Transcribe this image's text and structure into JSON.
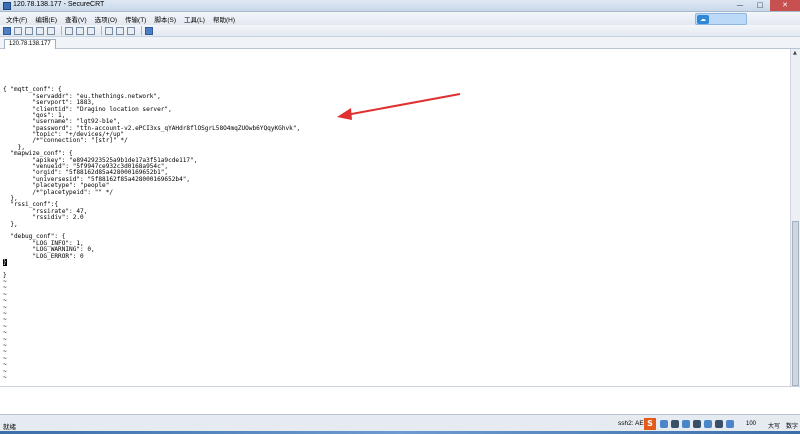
{
  "window": {
    "title": "120.78.138.177 - SecureCRT",
    "controls": [
      "—",
      "□",
      "✕"
    ]
  },
  "menu": [
    "文件(F)",
    "编辑(E)",
    "查看(V)",
    "选项(O)",
    "传输(T)",
    "脚本(S)",
    "工具(L)",
    "帮助(H)"
  ],
  "toolbar": {
    "buttons": [
      "connect-icon",
      "quick-connect-icon",
      "connect-tab-icon",
      "reconnect-icon",
      "disconnect-icon",
      "copy-icon",
      "paste-icon",
      "find-icon",
      "print-icon",
      "settings-icon",
      "keymap-icon",
      "help-icon"
    ]
  },
  "tab": {
    "label": "120.78.138.177"
  },
  "terminal": {
    "lines": [
      "",
      "",
      "",
      "",
      "",
      "",
      "{ \"mqtt_conf\": {",
      "        \"servaddr\": \"eu.thethings.network\",",
      "        \"servport\": 1883,",
      "        \"clientid\": \"Dragino location server\",",
      "        \"qos\": 1,",
      "        \"username\": \"lgt92-b1e\",",
      "        \"password\": \"ttn-account-v2.ePCI3xs_qYAHdr8flOSgrL58O4mqZUOwb6YQqyKGhvk\",",
      "        \"topic\": \"+/devices/+/up\"",
      "        /*\"connection\": \"[str]\" */",
      "    },",
      "  \"mapwize_conf\": {",
      "        \"apikey\": \"e8942923525a9b1de17a3f51a9cde117\",",
      "        \"venueid\": \"5f9947ce932c3d0168a954c\",",
      "        \"orgid\": \"5f88162d85a428000169652b1\",",
      "        \"universesid\": \"5f88162f85a428000169652b4\",",
      "        \"placetype\": \"people\"",
      "        /*\"placetypeid\": \"\" */",
      "  },",
      "  \"rssi_conf\":{",
      "        \"rssirate\": 47,",
      "        \"rssidiv\": 2.0",
      "  },",
      "",
      "  \"debug_conf\": {",
      "        \"LOG_INFO\": 1,",
      "        \"LOG_WARNING\": 0,",
      "        \"LOG_ERROR\": 0",
      "  }",
      "",
      "}",
      "~",
      "~",
      "~",
      "~",
      "~",
      "~",
      "~",
      "~",
      "~",
      "~",
      "~",
      "~",
      "~",
      "~",
      "~",
      "~"
    ],
    "cursor_line_index": 33,
    "cursor_char": "}"
  },
  "status": {
    "ready": "就绪",
    "connection": "ssh2: AES",
    "ime_label": "S",
    "num": "100",
    "size_label": "大写",
    "extra": "数字"
  },
  "colors": {
    "arrow": "#e03030",
    "accent": "#3c6ea8"
  }
}
